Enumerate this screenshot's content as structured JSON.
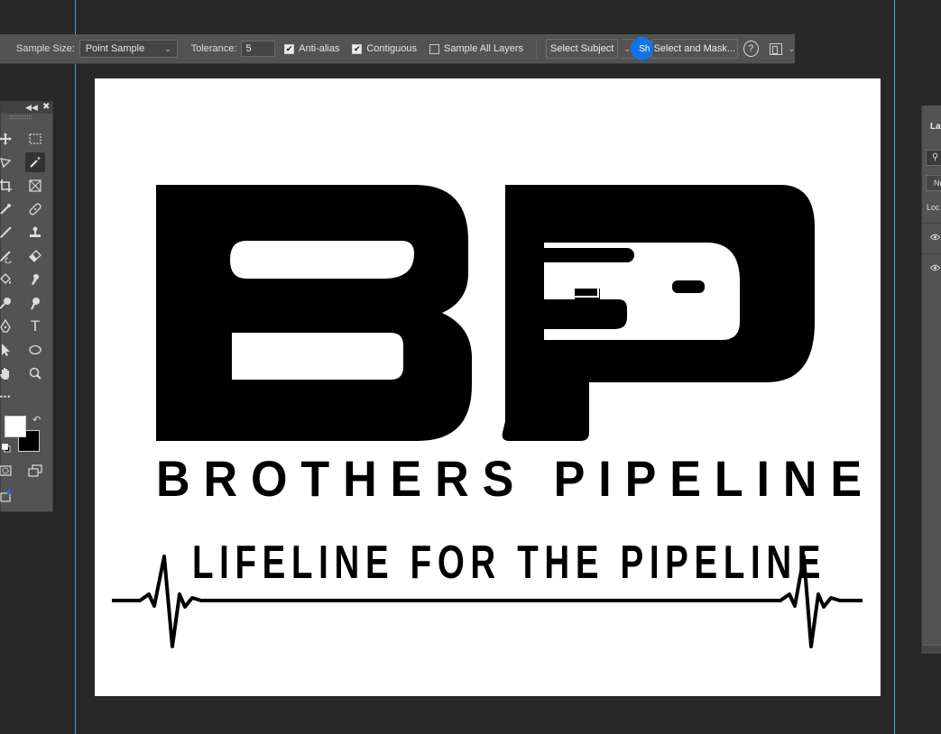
{
  "options_bar": {
    "sample_size_label": "Sample Size:",
    "sample_size_value": "Point Sample",
    "tolerance_label": "Tolerance:",
    "tolerance_value": "5",
    "anti_alias_label": "Anti-alias",
    "anti_alias_checked": true,
    "contiguous_label": "Contiguous",
    "contiguous_checked": true,
    "sample_all_layers_label": "Sample All Layers",
    "sample_all_layers_checked": false,
    "select_subject_label": "Select Subject",
    "badge_label": "Sh",
    "select_and_mask_label": "Select and Mask...",
    "help_glyph": "?"
  },
  "tools": {
    "active_tool": "magic-wand",
    "foreground_color": "#ffffff",
    "background_color": "#000000",
    "type_tool_glyph": "T",
    "more_tools_glyph": "•••"
  },
  "layers_panel": {
    "tab_label": "Lay",
    "blend_mode": "No",
    "lock_label": "Loc"
  },
  "canvas": {
    "company_name": "BROTHERS  PIPELINE",
    "tagline": "LIFELINE FOR THE PIPELINE",
    "monogram": "BP"
  },
  "colors": {
    "accent_blue": "#1473e6",
    "guide_cyan": "#1fbfc4",
    "panel_gray": "#535353",
    "workspace_gray": "#282828"
  }
}
